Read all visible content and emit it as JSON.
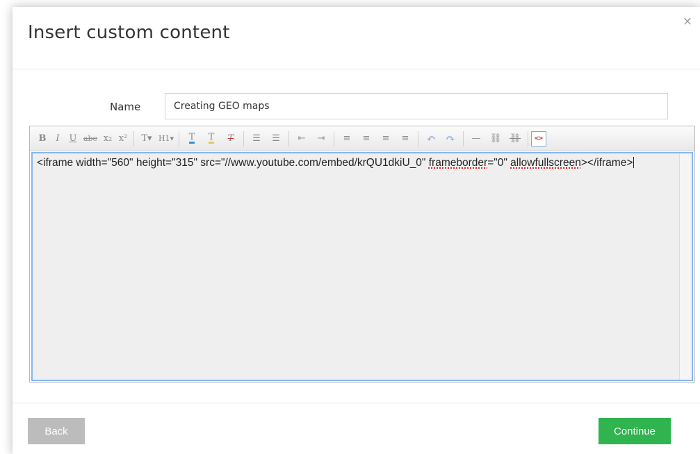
{
  "dialog": {
    "title": "Insert custom content",
    "close_glyph": "×"
  },
  "form": {
    "name_label": "Name",
    "name_value": "Creating GEO maps"
  },
  "editor": {
    "toolbar": [
      {
        "name": "bold-icon",
        "glyph": "B"
      },
      {
        "name": "italic-icon",
        "glyph": "I"
      },
      {
        "name": "underline-icon",
        "glyph": "U"
      },
      {
        "name": "strikethrough-icon",
        "glyph": "abe"
      },
      {
        "name": "subscript-icon",
        "glyph": "x₂"
      },
      {
        "name": "superscript-icon",
        "glyph": "x²"
      },
      {
        "name": "font-size-icon",
        "glyph": "T▾"
      },
      {
        "name": "heading-icon",
        "glyph": "H1▾"
      },
      {
        "name": "text-color-icon",
        "glyph": "T"
      },
      {
        "name": "highlight-icon",
        "glyph": "T"
      },
      {
        "name": "clear-formatting-icon",
        "glyph": "T"
      },
      {
        "name": "bullet-list-icon",
        "glyph": "☰"
      },
      {
        "name": "numbered-list-icon",
        "glyph": "☰"
      },
      {
        "name": "outdent-icon",
        "glyph": "⇤"
      },
      {
        "name": "indent-icon",
        "glyph": "⇥"
      },
      {
        "name": "align-left-icon",
        "glyph": "≡"
      },
      {
        "name": "align-center-icon",
        "glyph": "≡"
      },
      {
        "name": "align-right-icon",
        "glyph": "≡"
      },
      {
        "name": "align-justify-icon",
        "glyph": "≡"
      },
      {
        "name": "undo-icon",
        "glyph": "↶"
      },
      {
        "name": "redo-icon",
        "glyph": "↷"
      },
      {
        "name": "horizontal-rule-icon",
        "glyph": "—"
      },
      {
        "name": "link-icon",
        "glyph": "⛓"
      },
      {
        "name": "unlink-icon",
        "glyph": "⛓"
      },
      {
        "name": "source-code-icon",
        "glyph": "<>"
      }
    ],
    "content_parts": [
      "<iframe width=\"560\" height=\"315\" src=\"//www.youtube.com/embed/krQU1dkiU_0\" ",
      "frameborder",
      "=\"0\" ",
      "allowfullscreen",
      "></iframe>"
    ]
  },
  "footer": {
    "back_label": "Back",
    "continue_label": "Continue"
  },
  "colors": {
    "continue_button": "#2fb44f",
    "back_button": "#bcbcbc",
    "editor_focus_border": "#86b7f0",
    "editor_background": "#efefef"
  }
}
